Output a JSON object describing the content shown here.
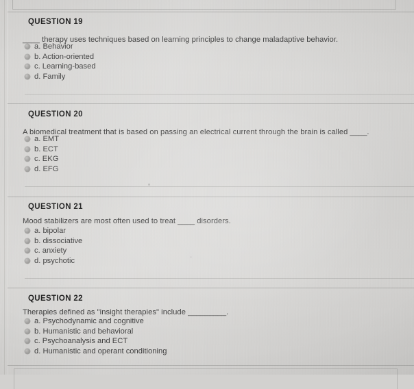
{
  "page": {
    "background_color": "#d2d1cf",
    "text_color": "#3c3c3c",
    "heading_color": "#1e1e1e"
  },
  "questions": [
    {
      "heading": "QUESTION 19",
      "text_before": "",
      "blank": "____",
      "text_after": " therapy uses techniques based on learning principles to change maladaptive behavior.",
      "options": [
        {
          "label": "a. Behavior",
          "selected": false
        },
        {
          "label": "b. Action-oriented",
          "selected": false
        },
        {
          "label": "c. Learning-based",
          "selected": false
        },
        {
          "label": "d. Family",
          "selected": false
        }
      ]
    },
    {
      "heading": "QUESTION 20",
      "text_before": "A biomedical treatment that is based on passing an electrical current through the brain is called ",
      "blank": "____",
      "text_after": ".",
      "options": [
        {
          "label": "a. EMT",
          "selected": false
        },
        {
          "label": "b. ECT",
          "selected": false
        },
        {
          "label": "c. EKG",
          "selected": false
        },
        {
          "label": "d. EFG",
          "selected": false
        }
      ]
    },
    {
      "heading": "QUESTION 21",
      "text_before": "Mood stabilizers are most often used to treat ",
      "blank": "____",
      "text_after": " disorders.",
      "options": [
        {
          "label": "a. bipolar",
          "selected": false
        },
        {
          "label": "b. dissociative",
          "selected": false
        },
        {
          "label": "c. anxiety",
          "selected": false
        },
        {
          "label": "d. psychotic",
          "selected": false
        }
      ]
    },
    {
      "heading": "QUESTION 22",
      "text_before": "Therapies defined as \"insight therapies\" include ",
      "blank": "_________",
      "text_after": ".",
      "options": [
        {
          "label": "a. Psychodynamic and cognitive",
          "selected": false
        },
        {
          "label": "b. Humanistic and behavioral",
          "selected": false
        },
        {
          "label": "c. Psychoanalysis and ECT",
          "selected": false
        },
        {
          "label": "d. Humanistic and operant conditioning",
          "selected": false
        }
      ]
    }
  ]
}
